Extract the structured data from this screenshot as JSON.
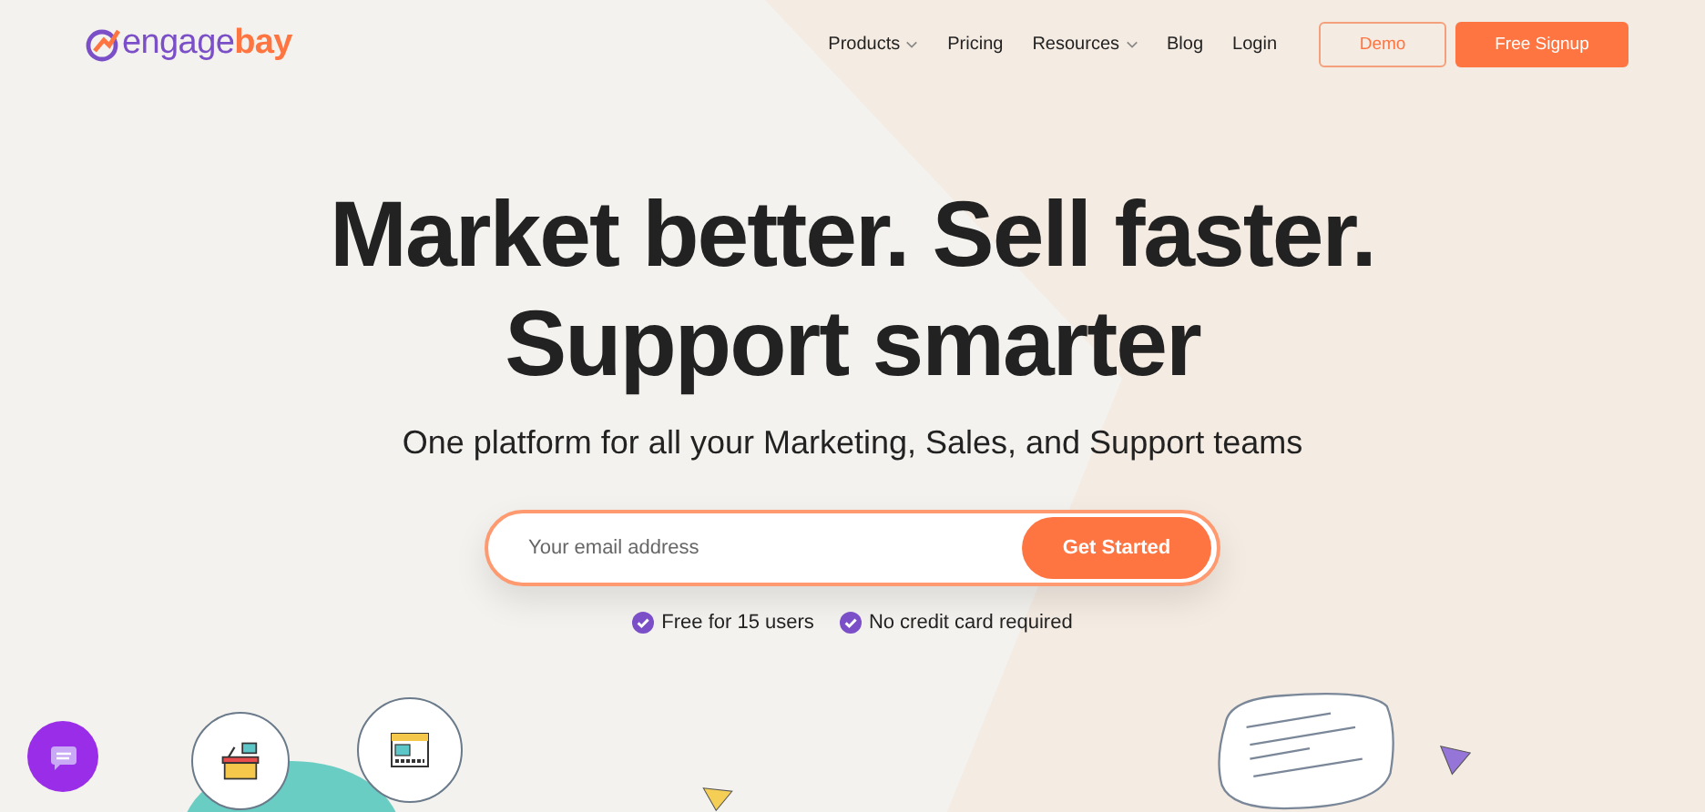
{
  "logo": {
    "primary": "engage",
    "accent": "bay"
  },
  "nav": [
    {
      "label": "Products",
      "dropdown": true
    },
    {
      "label": "Pricing",
      "dropdown": false
    },
    {
      "label": "Resources",
      "dropdown": true
    },
    {
      "label": "Blog",
      "dropdown": false
    },
    {
      "label": "Login",
      "dropdown": false
    }
  ],
  "header_buttons": [
    {
      "label": "Demo",
      "kind": "outline"
    },
    {
      "label": "Free Signup",
      "kind": "filled"
    }
  ],
  "hero": {
    "headline_lines": [
      "Market better. Sell faster.",
      "Support smarter"
    ],
    "subtitle": "One platform for all your Marketing, Sales, and Support teams"
  },
  "signup": {
    "placeholder": "Your email address",
    "button": "Get Started"
  },
  "benefits": [
    "Free for 15 users",
    "No credit card required"
  ]
}
